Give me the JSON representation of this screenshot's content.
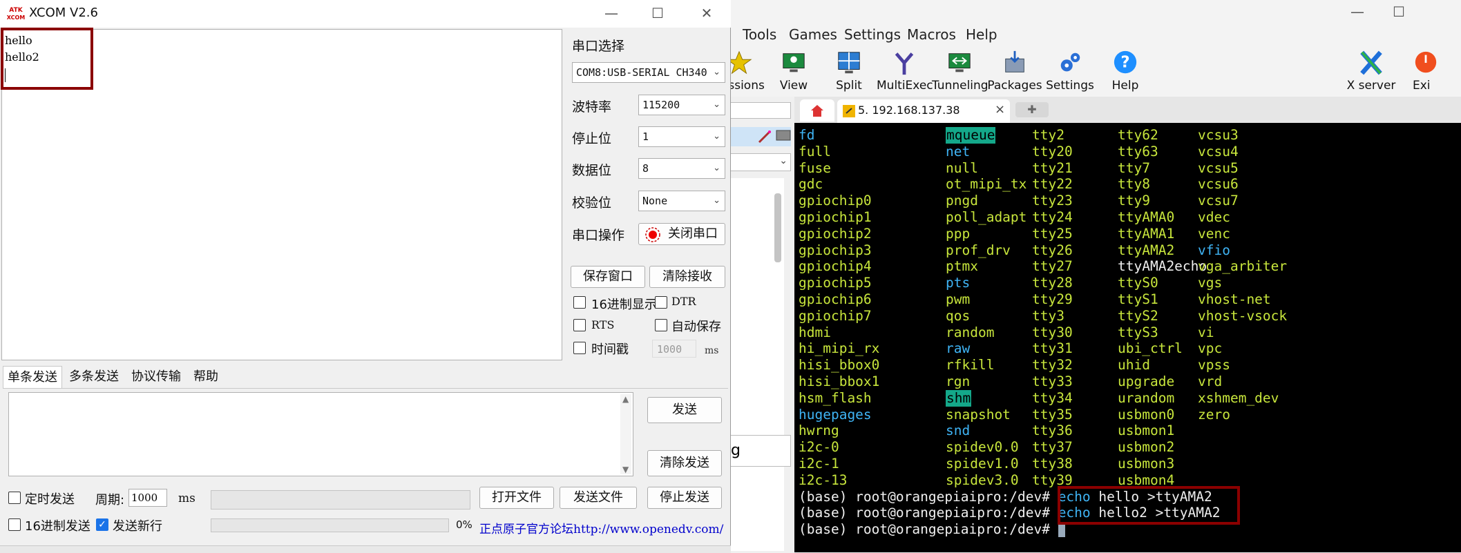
{
  "moba": {
    "window_controls": [
      "—",
      "☐"
    ],
    "menu": [
      "Tools",
      "Games",
      "Settings",
      "Macros",
      "Help"
    ],
    "toolbar": [
      "Sessions",
      "View",
      "Split",
      "MultiExec",
      "Tunneling",
      "Packages",
      "Settings",
      "Help",
      "X server",
      "Exi"
    ],
    "tab": {
      "label": "5. 192.168.137.38",
      "close": "×"
    },
    "sidebar_text": "g"
  },
  "terminal": {
    "col1": [
      {
        "t": "fd",
        "c": "b"
      },
      {
        "t": "full",
        "c": "g"
      },
      {
        "t": "fuse",
        "c": "g"
      },
      {
        "t": "gdc",
        "c": "g"
      },
      {
        "t": "gpiochip0",
        "c": "g"
      },
      {
        "t": "gpiochip1",
        "c": "g"
      },
      {
        "t": "gpiochip2",
        "c": "g"
      },
      {
        "t": "gpiochip3",
        "c": "g"
      },
      {
        "t": "gpiochip4",
        "c": "g"
      },
      {
        "t": "gpiochip5",
        "c": "g"
      },
      {
        "t": "gpiochip6",
        "c": "g"
      },
      {
        "t": "gpiochip7",
        "c": "g"
      },
      {
        "t": "hdmi",
        "c": "g"
      },
      {
        "t": "hi_mipi_rx",
        "c": "g"
      },
      {
        "t": "hisi_bbox0",
        "c": "g"
      },
      {
        "t": "hisi_bbox1",
        "c": "g"
      },
      {
        "t": "hsm_flash",
        "c": "g"
      },
      {
        "t": "hugepages",
        "c": "b"
      },
      {
        "t": "hwrng",
        "c": "g"
      },
      {
        "t": "i2c-0",
        "c": "g"
      },
      {
        "t": "i2c-1",
        "c": "g"
      },
      {
        "t": "i2c-13",
        "c": "g"
      }
    ],
    "col2": [
      {
        "t": "mqueue",
        "c": "hl"
      },
      {
        "t": "net",
        "c": "b"
      },
      {
        "t": "null",
        "c": "g"
      },
      {
        "t": "ot_mipi_tx",
        "c": "g"
      },
      {
        "t": "pngd",
        "c": "g"
      },
      {
        "t": "poll_adapt",
        "c": "g"
      },
      {
        "t": "ppp",
        "c": "g"
      },
      {
        "t": "prof_drv",
        "c": "g"
      },
      {
        "t": "ptmx",
        "c": "g"
      },
      {
        "t": "pts",
        "c": "b"
      },
      {
        "t": "pwm",
        "c": "g"
      },
      {
        "t": "qos",
        "c": "g"
      },
      {
        "t": "random",
        "c": "g"
      },
      {
        "t": "raw",
        "c": "b"
      },
      {
        "t": "rfkill",
        "c": "g"
      },
      {
        "t": "rgn",
        "c": "g"
      },
      {
        "t": "shm",
        "c": "hl"
      },
      {
        "t": "snapshot",
        "c": "g"
      },
      {
        "t": "snd",
        "c": "b"
      },
      {
        "t": "spidev0.0",
        "c": "g"
      },
      {
        "t": "spidev1.0",
        "c": "g"
      },
      {
        "t": "spidev3.0",
        "c": "g"
      }
    ],
    "col3": [
      {
        "t": "tty2",
        "c": "g"
      },
      {
        "t": "tty20",
        "c": "g"
      },
      {
        "t": "tty21",
        "c": "g"
      },
      {
        "t": "tty22",
        "c": "g"
      },
      {
        "t": "tty23",
        "c": "g"
      },
      {
        "t": "tty24",
        "c": "g"
      },
      {
        "t": "tty25",
        "c": "g"
      },
      {
        "t": "tty26",
        "c": "g"
      },
      {
        "t": "tty27",
        "c": "g"
      },
      {
        "t": "tty28",
        "c": "g"
      },
      {
        "t": "tty29",
        "c": "g"
      },
      {
        "t": "tty3",
        "c": "g"
      },
      {
        "t": "tty30",
        "c": "g"
      },
      {
        "t": "tty31",
        "c": "g"
      },
      {
        "t": "tty32",
        "c": "g"
      },
      {
        "t": "tty33",
        "c": "g"
      },
      {
        "t": "tty34",
        "c": "g"
      },
      {
        "t": "tty35",
        "c": "g"
      },
      {
        "t": "tty36",
        "c": "g"
      },
      {
        "t": "tty37",
        "c": "g"
      },
      {
        "t": "tty38",
        "c": "g"
      },
      {
        "t": "tty39",
        "c": "g"
      }
    ],
    "col4": [
      {
        "t": "tty62",
        "c": "g"
      },
      {
        "t": "tty63",
        "c": "g"
      },
      {
        "t": "tty7",
        "c": "g"
      },
      {
        "t": "tty8",
        "c": "g"
      },
      {
        "t": "tty9",
        "c": "g"
      },
      {
        "t": "ttyAMA0",
        "c": "g"
      },
      {
        "t": "ttyAMA1",
        "c": "g"
      },
      {
        "t": "ttyAMA2",
        "c": "g"
      },
      {
        "t": "ttyAMA2echo",
        "c": "w"
      },
      {
        "t": "ttyS0",
        "c": "g"
      },
      {
        "t": "ttyS1",
        "c": "g"
      },
      {
        "t": "ttyS2",
        "c": "g"
      },
      {
        "t": "ttyS3",
        "c": "g"
      },
      {
        "t": "ubi_ctrl",
        "c": "g"
      },
      {
        "t": "uhid",
        "c": "g"
      },
      {
        "t": "upgrade",
        "c": "g"
      },
      {
        "t": "urandom",
        "c": "g"
      },
      {
        "t": "usbmon0",
        "c": "g"
      },
      {
        "t": "usbmon1",
        "c": "g"
      },
      {
        "t": "usbmon2",
        "c": "g"
      },
      {
        "t": "usbmon3",
        "c": "g"
      },
      {
        "t": "usbmon4",
        "c": "g"
      }
    ],
    "col5": [
      {
        "t": "vcsu3",
        "c": "g"
      },
      {
        "t": "vcsu4",
        "c": "g"
      },
      {
        "t": "vcsu5",
        "c": "g"
      },
      {
        "t": "vcsu6",
        "c": "g"
      },
      {
        "t": "vcsu7",
        "c": "g"
      },
      {
        "t": "vdec",
        "c": "g"
      },
      {
        "t": "venc",
        "c": "g"
      },
      {
        "t": "vfio",
        "c": "b"
      },
      {
        "t": "vga_arbiter",
        "c": "g"
      },
      {
        "t": "vgs",
        "c": "g"
      },
      {
        "t": "vhost-net",
        "c": "g"
      },
      {
        "t": "vhost-vsock",
        "c": "g"
      },
      {
        "t": "vi",
        "c": "g"
      },
      {
        "t": "vpc",
        "c": "g"
      },
      {
        "t": "vpss",
        "c": "g"
      },
      {
        "t": "vrd",
        "c": "g"
      },
      {
        "t": "xshmem_dev",
        "c": "g"
      },
      {
        "t": "zero",
        "c": "g"
      }
    ],
    "prompts": [
      {
        "prompt": "(base) root@orangepiaipro:/dev# ",
        "cmd": "echo",
        "args": " hello >ttyAMA2"
      },
      {
        "prompt": "(base) root@orangepiaipro:/dev# ",
        "cmd": "echo",
        "args": " hello2 >ttyAMA2"
      },
      {
        "prompt": "(base) root@orangepiaipro:/dev# ",
        "cmd": "",
        "args": ""
      }
    ]
  },
  "xcom": {
    "title": "XCOM V2.6",
    "logo_text": "ATK XCOM",
    "window_controls": [
      "—",
      "☐",
      "✕"
    ],
    "received_lines": [
      "hello",
      "hello2"
    ],
    "serial_select_label": "串口选择",
    "port_value": "COM8:USB-SERIAL CH340",
    "baud_label": "波特率",
    "baud_value": "115200",
    "stopbits_label": "停止位",
    "stopbits_value": "1",
    "databits_label": "数据位",
    "databits_value": "8",
    "parity_label": "校验位",
    "parity_value": "None",
    "serial_op_label": "串口操作",
    "close_port_button": "关闭串口",
    "save_window_button": "保存窗口",
    "clear_receive_button": "清除接收",
    "hex_display_label": "16进制显示",
    "dtr_label": "DTR",
    "rts_label": "RTS",
    "autosave_label": "自动保存",
    "timestamp_label": "时间戳",
    "timestamp_value": "1000",
    "timestamp_unit": "ms",
    "tabs": [
      "单条发送",
      "多条发送",
      "协议传输",
      "帮助"
    ],
    "send_button": "发送",
    "clear_send_button": "清除发送",
    "timed_send_label": "定时发送",
    "period_label": "周期:",
    "period_value": "1000",
    "period_unit": "ms",
    "open_file_button": "打开文件",
    "send_file_button": "发送文件",
    "stop_send_button": "停止发送",
    "hex_send_label": "16进制发送",
    "send_newline_label": "发送新行",
    "progress_text": "0%",
    "forum_link": "正点原子官方论坛http://www.openedv.com/"
  },
  "colors": {
    "terminal_bg": "#000000",
    "green": "#c8e63c",
    "blue": "#3fb4f5",
    "highlight": "#14a88a",
    "annotation_red": "#8b0000"
  }
}
